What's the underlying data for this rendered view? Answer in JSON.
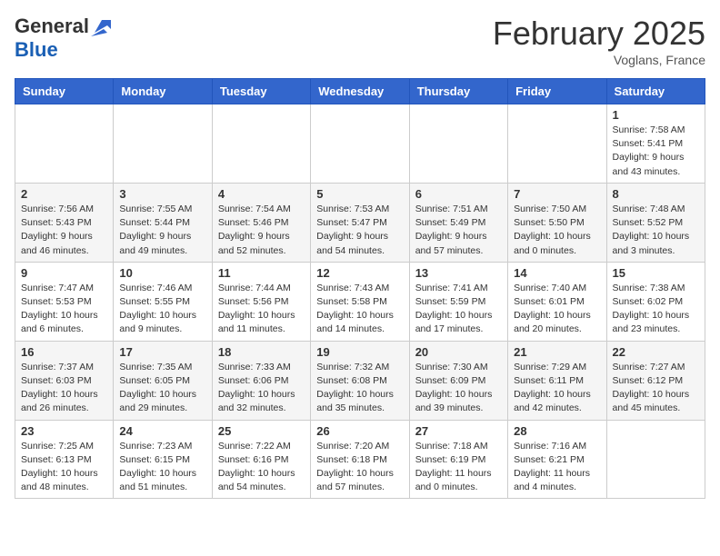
{
  "header": {
    "logo_general": "General",
    "logo_blue": "Blue",
    "month_title": "February 2025",
    "location": "Voglans, France"
  },
  "days_of_week": [
    "Sunday",
    "Monday",
    "Tuesday",
    "Wednesday",
    "Thursday",
    "Friday",
    "Saturday"
  ],
  "weeks": [
    [
      {
        "day": "",
        "info": ""
      },
      {
        "day": "",
        "info": ""
      },
      {
        "day": "",
        "info": ""
      },
      {
        "day": "",
        "info": ""
      },
      {
        "day": "",
        "info": ""
      },
      {
        "day": "",
        "info": ""
      },
      {
        "day": "1",
        "info": "Sunrise: 7:58 AM\nSunset: 5:41 PM\nDaylight: 9 hours and 43 minutes."
      }
    ],
    [
      {
        "day": "2",
        "info": "Sunrise: 7:56 AM\nSunset: 5:43 PM\nDaylight: 9 hours and 46 minutes."
      },
      {
        "day": "3",
        "info": "Sunrise: 7:55 AM\nSunset: 5:44 PM\nDaylight: 9 hours and 49 minutes."
      },
      {
        "day": "4",
        "info": "Sunrise: 7:54 AM\nSunset: 5:46 PM\nDaylight: 9 hours and 52 minutes."
      },
      {
        "day": "5",
        "info": "Sunrise: 7:53 AM\nSunset: 5:47 PM\nDaylight: 9 hours and 54 minutes."
      },
      {
        "day": "6",
        "info": "Sunrise: 7:51 AM\nSunset: 5:49 PM\nDaylight: 9 hours and 57 minutes."
      },
      {
        "day": "7",
        "info": "Sunrise: 7:50 AM\nSunset: 5:50 PM\nDaylight: 10 hours and 0 minutes."
      },
      {
        "day": "8",
        "info": "Sunrise: 7:48 AM\nSunset: 5:52 PM\nDaylight: 10 hours and 3 minutes."
      }
    ],
    [
      {
        "day": "9",
        "info": "Sunrise: 7:47 AM\nSunset: 5:53 PM\nDaylight: 10 hours and 6 minutes."
      },
      {
        "day": "10",
        "info": "Sunrise: 7:46 AM\nSunset: 5:55 PM\nDaylight: 10 hours and 9 minutes."
      },
      {
        "day": "11",
        "info": "Sunrise: 7:44 AM\nSunset: 5:56 PM\nDaylight: 10 hours and 11 minutes."
      },
      {
        "day": "12",
        "info": "Sunrise: 7:43 AM\nSunset: 5:58 PM\nDaylight: 10 hours and 14 minutes."
      },
      {
        "day": "13",
        "info": "Sunrise: 7:41 AM\nSunset: 5:59 PM\nDaylight: 10 hours and 17 minutes."
      },
      {
        "day": "14",
        "info": "Sunrise: 7:40 AM\nSunset: 6:01 PM\nDaylight: 10 hours and 20 minutes."
      },
      {
        "day": "15",
        "info": "Sunrise: 7:38 AM\nSunset: 6:02 PM\nDaylight: 10 hours and 23 minutes."
      }
    ],
    [
      {
        "day": "16",
        "info": "Sunrise: 7:37 AM\nSunset: 6:03 PM\nDaylight: 10 hours and 26 minutes."
      },
      {
        "day": "17",
        "info": "Sunrise: 7:35 AM\nSunset: 6:05 PM\nDaylight: 10 hours and 29 minutes."
      },
      {
        "day": "18",
        "info": "Sunrise: 7:33 AM\nSunset: 6:06 PM\nDaylight: 10 hours and 32 minutes."
      },
      {
        "day": "19",
        "info": "Sunrise: 7:32 AM\nSunset: 6:08 PM\nDaylight: 10 hours and 35 minutes."
      },
      {
        "day": "20",
        "info": "Sunrise: 7:30 AM\nSunset: 6:09 PM\nDaylight: 10 hours and 39 minutes."
      },
      {
        "day": "21",
        "info": "Sunrise: 7:29 AM\nSunset: 6:11 PM\nDaylight: 10 hours and 42 minutes."
      },
      {
        "day": "22",
        "info": "Sunrise: 7:27 AM\nSunset: 6:12 PM\nDaylight: 10 hours and 45 minutes."
      }
    ],
    [
      {
        "day": "23",
        "info": "Sunrise: 7:25 AM\nSunset: 6:13 PM\nDaylight: 10 hours and 48 minutes."
      },
      {
        "day": "24",
        "info": "Sunrise: 7:23 AM\nSunset: 6:15 PM\nDaylight: 10 hours and 51 minutes."
      },
      {
        "day": "25",
        "info": "Sunrise: 7:22 AM\nSunset: 6:16 PM\nDaylight: 10 hours and 54 minutes."
      },
      {
        "day": "26",
        "info": "Sunrise: 7:20 AM\nSunset: 6:18 PM\nDaylight: 10 hours and 57 minutes."
      },
      {
        "day": "27",
        "info": "Sunrise: 7:18 AM\nSunset: 6:19 PM\nDaylight: 11 hours and 0 minutes."
      },
      {
        "day": "28",
        "info": "Sunrise: 7:16 AM\nSunset: 6:21 PM\nDaylight: 11 hours and 4 minutes."
      },
      {
        "day": "",
        "info": ""
      }
    ]
  ]
}
